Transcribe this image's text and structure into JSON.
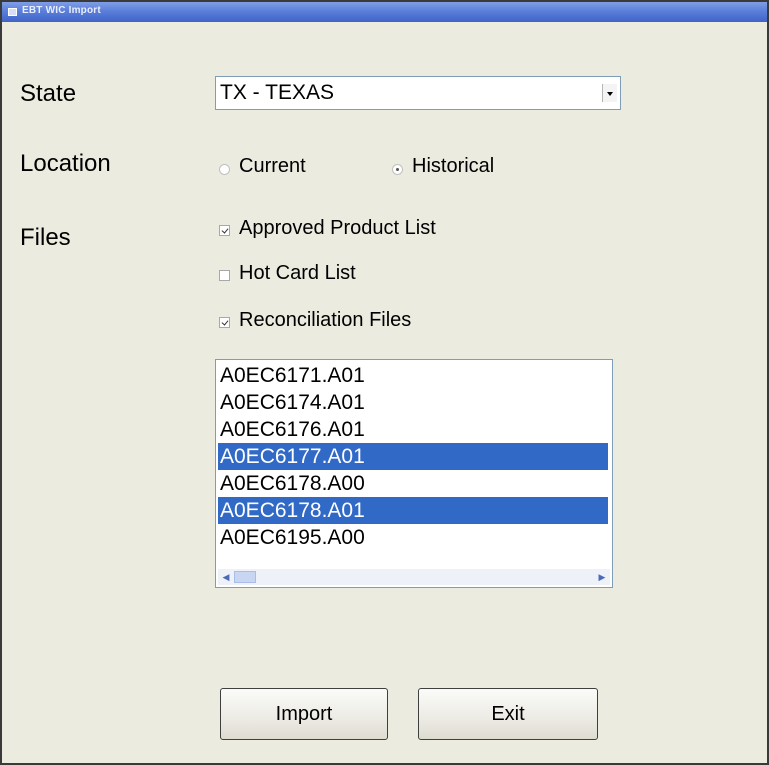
{
  "window": {
    "title": "EBT WIC Import"
  },
  "labels": {
    "state": "State",
    "location": "Location",
    "files": "Files"
  },
  "state": {
    "selected": "TX - TEXAS"
  },
  "location": {
    "options": [
      {
        "label": "Current",
        "checked": false
      },
      {
        "label": "Historical",
        "checked": true
      }
    ]
  },
  "files": {
    "options": [
      {
        "label": "Approved Product List",
        "checked": true
      },
      {
        "label": "Hot Card List",
        "checked": false
      },
      {
        "label": "Reconciliation Files",
        "checked": true
      }
    ]
  },
  "file_list": {
    "items": [
      {
        "name": "A0EC6171.A01",
        "selected": false
      },
      {
        "name": "A0EC6174.A01",
        "selected": false
      },
      {
        "name": "A0EC6176.A01",
        "selected": false
      },
      {
        "name": "A0EC6177.A01",
        "selected": true
      },
      {
        "name": "A0EC6178.A00",
        "selected": false
      },
      {
        "name": "A0EC6178.A01",
        "selected": true
      },
      {
        "name": "A0EC6195.A00",
        "selected": false
      }
    ]
  },
  "buttons": {
    "import": "Import",
    "exit": "Exit"
  },
  "colors": {
    "window_bg": "#ecebe0",
    "title_bar": "#5b7fd9",
    "selection": "#3169c6"
  }
}
